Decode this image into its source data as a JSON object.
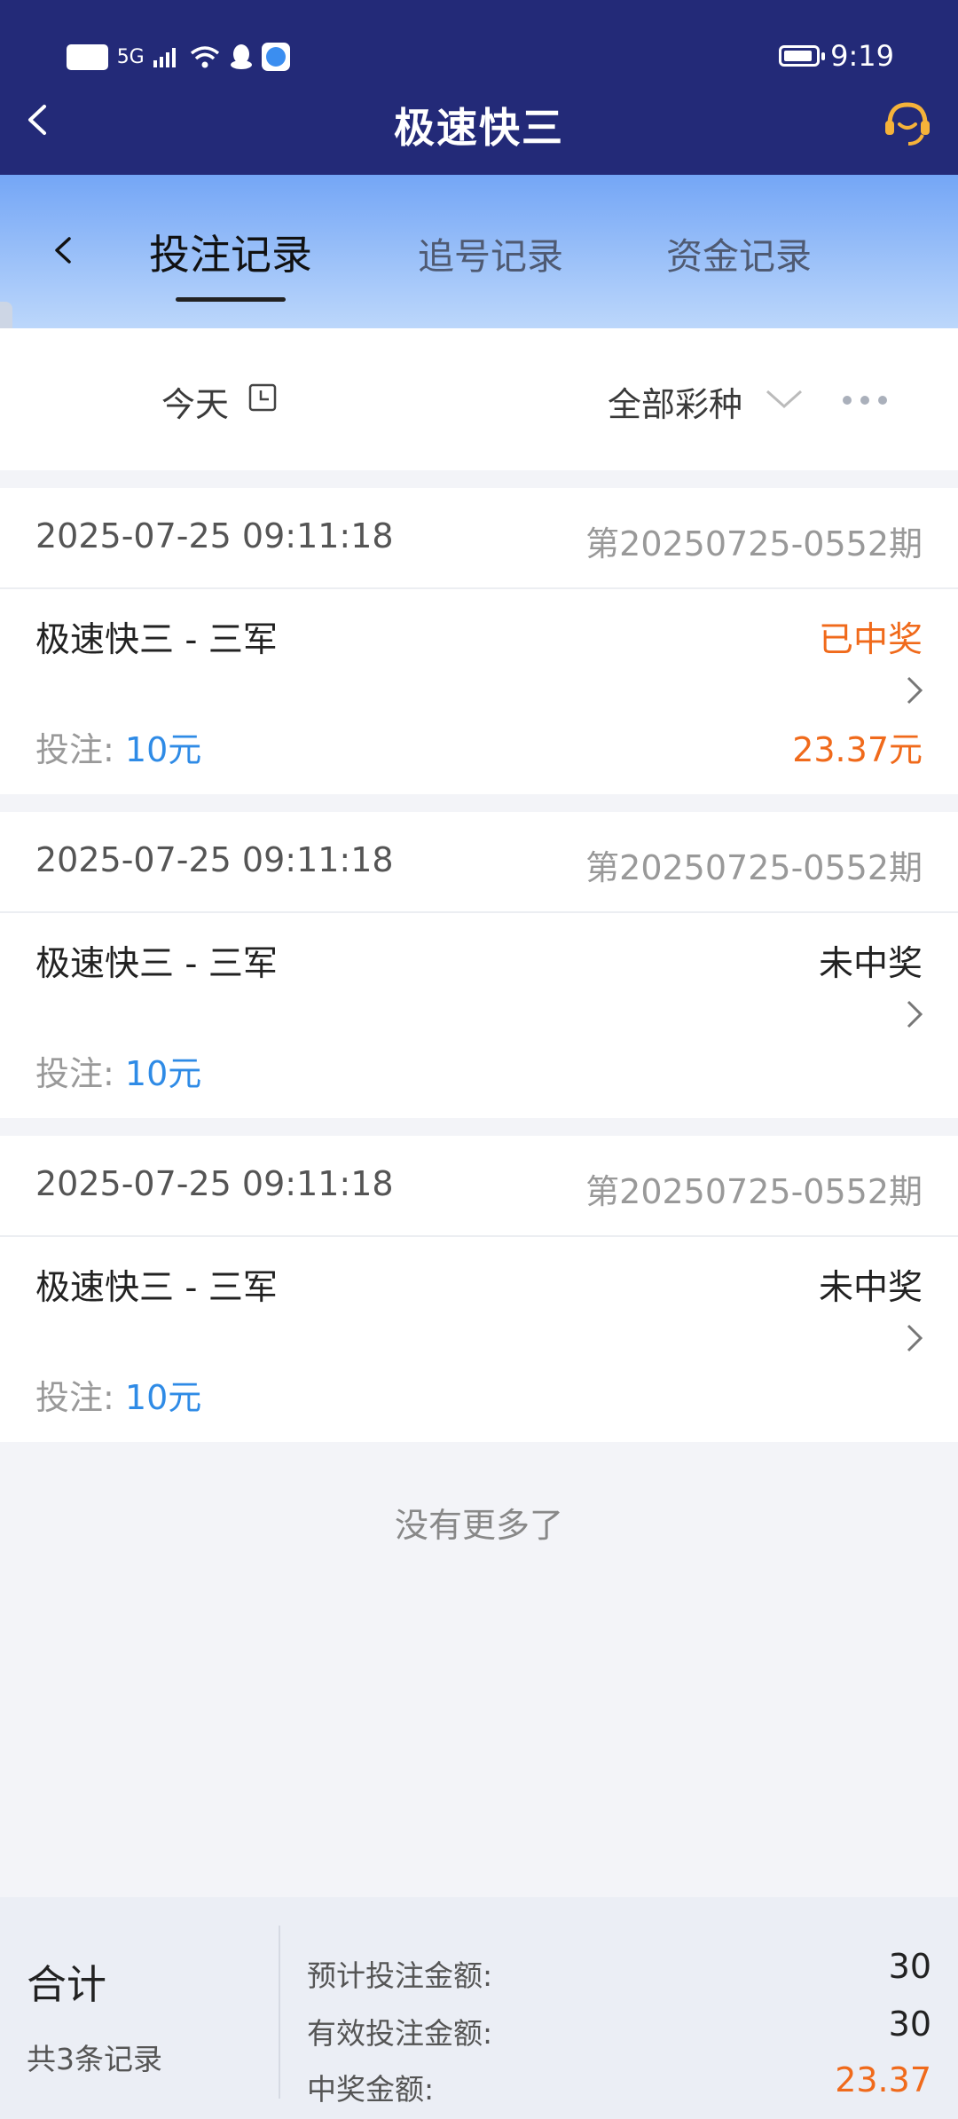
{
  "status_bar": {
    "network_badge": "HD",
    "signal": "5G",
    "time": "9:19"
  },
  "header": {
    "title": "极速快三",
    "icons": [
      "back-arrow-icon",
      "customer-service-icon"
    ]
  },
  "tabs": [
    {
      "label": "投注记录",
      "active": true
    },
    {
      "label": "追号记录",
      "active": false
    },
    {
      "label": "资金记录",
      "active": false
    }
  ],
  "filter": {
    "date": "今天",
    "lottery_type": "全部彩种"
  },
  "records": [
    {
      "time": "2025-07-25 09:11:18",
      "issue": "第20250725-0552期",
      "name": "极速快三 - 三军",
      "status": "已中奖",
      "bet_label": "投注: ",
      "bet_amount": "10元",
      "prize": "23.37元"
    },
    {
      "time": "2025-07-25 09:11:18",
      "issue": "第20250725-0552期",
      "name": "极速快三 - 三军",
      "status": "未中奖",
      "bet_label": "投注: ",
      "bet_amount": "10元",
      "prize": ""
    },
    {
      "time": "2025-07-25 09:11:18",
      "issue": "第20250725-0552期",
      "name": "极速快三 - 三军",
      "status": "未中奖",
      "bet_label": "投注: ",
      "bet_amount": "10元",
      "prize": ""
    }
  ],
  "list_end": "没有更多了",
  "summary": {
    "title": "合计",
    "count": "共3条记录",
    "expected_label": "预计投注金额:",
    "expected_value": "30",
    "valid_label": "有效投注金额:",
    "valid_value": "30",
    "prize_label": "中奖金额:",
    "prize_value": "23.37"
  },
  "colors": {
    "header_bg": "#232a78",
    "win_orange": "#f06a1b",
    "bet_blue": "#2f8be6"
  }
}
